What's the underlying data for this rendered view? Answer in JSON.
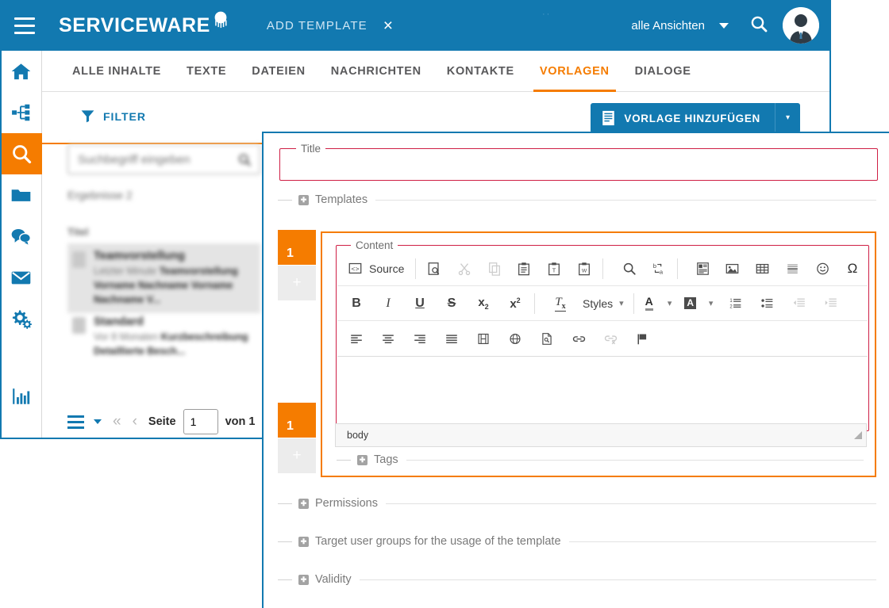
{
  "header": {
    "brand": "SERVICEWARE",
    "page_action": "ADD TEMPLATE",
    "close_label": "×",
    "views_label": "alle Ansichten",
    "dots": "··",
    "icons": {
      "menu": "hamburger-icon",
      "search": "search-icon",
      "avatar": "user-avatar"
    },
    "accent_blue": "#1279b0",
    "accent_orange": "#f57c00"
  },
  "sidebar": {
    "items": [
      {
        "name": "home",
        "label": "Home",
        "active": false
      },
      {
        "name": "hierarchy",
        "label": "Strukturen",
        "active": false
      },
      {
        "name": "search",
        "label": "Suche",
        "active": true
      },
      {
        "name": "folder",
        "label": "Ordner",
        "active": false
      },
      {
        "name": "chat",
        "label": "Chat",
        "active": false
      },
      {
        "name": "mail",
        "label": "E-Mail",
        "active": false
      },
      {
        "name": "settings",
        "label": "Einstellungen",
        "active": false
      },
      {
        "name": "reports",
        "label": "Auswertungen",
        "active": false
      }
    ]
  },
  "tabs": [
    {
      "label": "ALLE INHALTE",
      "active": false
    },
    {
      "label": "TEXTE",
      "active": false
    },
    {
      "label": "DATEIEN",
      "active": false
    },
    {
      "label": "NACHRICHTEN",
      "active": false
    },
    {
      "label": "KONTAKTE",
      "active": false
    },
    {
      "label": "VORLAGEN",
      "active": true
    },
    {
      "label": "DIALOGE",
      "active": false
    }
  ],
  "toolbar": {
    "filter_label": "FILTER",
    "add_template_label": "VORLAGE HINZUFÜGEN",
    "add_template_dropdown": "▾"
  },
  "results": {
    "search_placeholder": "Suchbegriff eingeben",
    "search_value": "",
    "count_label": "Ergebnisse 2",
    "column_header": "Titel",
    "items": [
      {
        "title": "Teamvorstellung",
        "meta": "Letzter Minute",
        "snippet": "Teamvorstellung Vorname Nachname Vorname Nachname V...",
        "selected": true
      },
      {
        "title": "Standard",
        "meta": "Vor 8 Monaten",
        "snippet": "Kurzbeschreibung Detaillierte Besch...",
        "selected": false
      }
    ]
  },
  "pagination": {
    "page_word": "Seite",
    "page_value": "1",
    "of_label": "von 1",
    "first_icon": "«",
    "prev_icon": "‹"
  },
  "dialog": {
    "title_field": {
      "legend": "Title",
      "value": "",
      "required": true
    },
    "sections": [
      {
        "name": "templates",
        "label": "Templates",
        "expanded": true
      },
      {
        "name": "tags",
        "label": "Tags",
        "expanded": false
      },
      {
        "name": "permissions",
        "label": "Permissions",
        "expanded": false
      },
      {
        "name": "target-user-groups",
        "label": "Target user groups for the usage of the template",
        "expanded": false
      },
      {
        "name": "validity",
        "label": "Validity",
        "expanded": false
      }
    ],
    "rows": [
      {
        "number": "1",
        "add_label": "+"
      },
      {
        "number": "1",
        "add_label": "+"
      }
    ],
    "content_field": {
      "legend": "Content",
      "value": ""
    },
    "editor": {
      "source_label": "Source",
      "styles_label": "Styles",
      "path": "body",
      "toolbar_rows": [
        [
          {
            "name": "source-button",
            "icon": "source-code-icon",
            "label": "Source",
            "disabled": false
          },
          {
            "name": "sep",
            "icon": "separator"
          },
          {
            "name": "preview-button",
            "icon": "preview-icon",
            "disabled": false
          },
          {
            "name": "cut-button",
            "icon": "scissors-icon",
            "disabled": true
          },
          {
            "name": "copy-button",
            "icon": "copy-icon",
            "disabled": true
          },
          {
            "name": "paste-button",
            "icon": "paste-icon",
            "disabled": false
          },
          {
            "name": "paste-text-button",
            "icon": "paste-as-text-icon",
            "disabled": false
          },
          {
            "name": "paste-word-button",
            "icon": "paste-from-word-icon",
            "disabled": false
          },
          {
            "name": "sep",
            "icon": "separator"
          },
          {
            "name": "find-button",
            "icon": "magnifier-icon",
            "disabled": false
          },
          {
            "name": "replace-button",
            "icon": "find-replace-icon",
            "disabled": false
          },
          {
            "name": "sep",
            "icon": "separator"
          },
          {
            "name": "templates-button",
            "icon": "document-templates-icon",
            "disabled": false
          },
          {
            "name": "image-button",
            "icon": "image-icon",
            "disabled": false
          },
          {
            "name": "table-button",
            "icon": "table-icon",
            "disabled": false
          },
          {
            "name": "hrule-button",
            "icon": "horizontal-rule-icon",
            "disabled": false
          },
          {
            "name": "smiley-button",
            "icon": "smiley-icon",
            "disabled": false
          },
          {
            "name": "special-char-button",
            "icon": "omega-icon",
            "disabled": false
          }
        ],
        [
          {
            "name": "bold-button",
            "icon": "bold-icon",
            "text": "B",
            "disabled": false
          },
          {
            "name": "italic-button",
            "icon": "italic-icon",
            "text": "I",
            "disabled": false
          },
          {
            "name": "underline-button",
            "icon": "underline-icon",
            "text": "U",
            "disabled": false
          },
          {
            "name": "strike-button",
            "icon": "strikethrough-icon",
            "text": "S",
            "disabled": false
          },
          {
            "name": "subscript-button",
            "icon": "subscript-icon",
            "disabled": false
          },
          {
            "name": "superscript-button",
            "icon": "superscript-icon",
            "disabled": false
          },
          {
            "name": "sep",
            "icon": "separator"
          },
          {
            "name": "remove-format-button",
            "icon": "remove-format-icon",
            "disabled": false
          },
          {
            "name": "styles-dropdown",
            "icon": "chevron-down-icon",
            "label": "Styles",
            "disabled": false
          },
          {
            "name": "sep",
            "icon": "separator"
          },
          {
            "name": "text-color-button",
            "icon": "text-color-icon",
            "disabled": false
          },
          {
            "name": "bg-color-button",
            "icon": "background-color-icon",
            "disabled": false
          },
          {
            "name": "numbered-list-button",
            "icon": "numbered-list-icon",
            "disabled": false
          },
          {
            "name": "bulleted-list-button",
            "icon": "bulleted-list-icon",
            "disabled": false
          },
          {
            "name": "outdent-button",
            "icon": "decrease-indent-icon",
            "disabled": true
          },
          {
            "name": "indent-button",
            "icon": "increase-indent-icon",
            "disabled": true
          }
        ],
        [
          {
            "name": "align-left-button",
            "icon": "align-left-icon",
            "disabled": false
          },
          {
            "name": "align-center-button",
            "icon": "align-center-icon",
            "disabled": false
          },
          {
            "name": "align-right-button",
            "icon": "align-right-icon",
            "disabled": false
          },
          {
            "name": "align-justify-button",
            "icon": "align-justify-icon",
            "disabled": false
          },
          {
            "name": "video-button",
            "icon": "film-icon",
            "disabled": false
          },
          {
            "name": "iframe-button",
            "icon": "globe-icon",
            "disabled": false
          },
          {
            "name": "doc-link-button",
            "icon": "document-link-icon",
            "disabled": false
          },
          {
            "name": "link-button",
            "icon": "chain-link-icon",
            "disabled": false
          },
          {
            "name": "unlink-button",
            "icon": "broken-link-icon",
            "disabled": true
          },
          {
            "name": "anchor-button",
            "icon": "flag-icon",
            "disabled": false
          }
        ]
      ]
    }
  }
}
